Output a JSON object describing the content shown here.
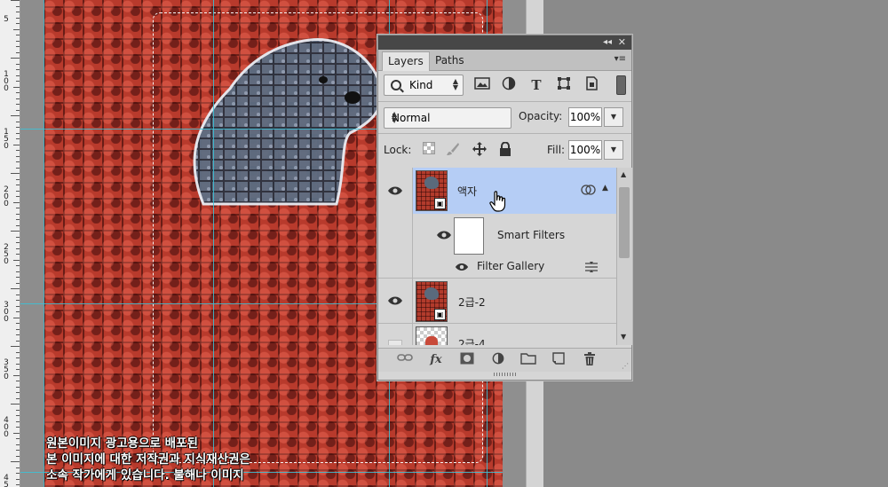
{
  "ruler": {
    "labels": [
      "5",
      "100",
      "150",
      "200",
      "250",
      "300",
      "350",
      "400",
      "450"
    ]
  },
  "caption": {
    "lines": [
      "원본이미지 광고용으로 배포된",
      "본 이미지에 대한 저작권과 지식재산권은",
      "소속 작가에게 있습니다. 불해나 이미지"
    ]
  },
  "panel": {
    "tabs": [
      {
        "label": "Layers",
        "active": true
      },
      {
        "label": "Paths",
        "active": false
      }
    ],
    "collapse_glyph": "◂◂",
    "close_glyph": "✕",
    "menu_glyph": "▾≡",
    "filter": {
      "kind_label": "Kind",
      "icons": [
        "image-filter-icon",
        "adjustment-filter-icon",
        "type-filter-icon",
        "shape-filter-icon",
        "smart-object-filter-icon"
      ]
    },
    "blend": {
      "mode": "Normal",
      "opacity_label": "Opacity:",
      "opacity_value": "100%",
      "lock_label": "Lock:",
      "fill_label": "Fill:",
      "fill_value": "100%"
    },
    "layers": [
      {
        "name": "액자",
        "selected": true,
        "visible": true,
        "type": "smart-object"
      },
      {
        "name": "Smart Filters",
        "sub": true,
        "visible": true
      },
      {
        "name": "Filter Gallery",
        "sub": true,
        "visible": true
      },
      {
        "name": "2급-2",
        "selected": false,
        "visible": true,
        "type": "smart-object"
      },
      {
        "name": "2급-4",
        "selected": false,
        "visible": false,
        "type": "smart-object"
      }
    ],
    "bottom_icons": [
      "link-layers-icon",
      "fx-icon",
      "add-mask-icon",
      "new-adjustment-icon",
      "new-group-icon",
      "new-layer-icon",
      "delete-layer-icon"
    ],
    "fx_label": "fx"
  },
  "colors": {
    "selected_row": "#b5cdf5",
    "guide": "#39c3d8",
    "canvas_red": "#b83a2c"
  }
}
